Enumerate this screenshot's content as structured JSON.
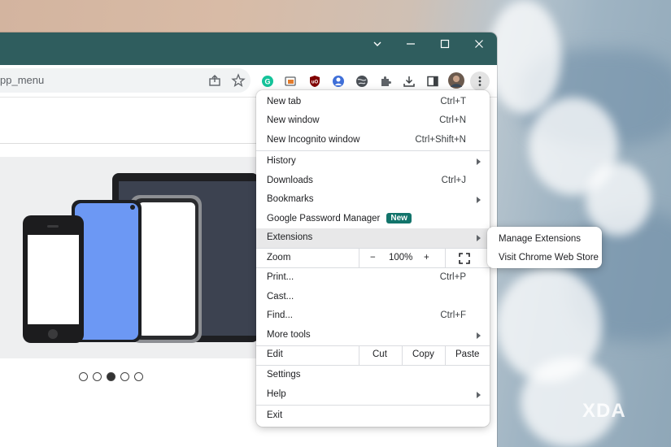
{
  "omnibox": {
    "text": "pp_menu"
  },
  "toolbar": {
    "icons": [
      "share-icon",
      "bookmark-star-icon",
      "grammarly-extension-icon",
      "screenshot-extension-icon",
      "ublock-extension-icon",
      "vpn-extension-icon",
      "globe-extension-icon",
      "extensions-puzzle-icon",
      "download-icon",
      "side-panel-icon",
      "profile-avatar",
      "kebab-menu-icon"
    ]
  },
  "menu": {
    "new_tab": {
      "label": "New tab",
      "shortcut": "Ctrl+T"
    },
    "new_window": {
      "label": "New window",
      "shortcut": "Ctrl+N"
    },
    "new_incognito": {
      "label": "New Incognito window",
      "shortcut": "Ctrl+Shift+N"
    },
    "history": {
      "label": "History"
    },
    "downloads": {
      "label": "Downloads",
      "shortcut": "Ctrl+J"
    },
    "bookmarks": {
      "label": "Bookmarks"
    },
    "password_manager": {
      "label": "Google Password Manager",
      "badge": "New"
    },
    "extensions": {
      "label": "Extensions"
    },
    "zoom": {
      "label": "Zoom",
      "minus": "−",
      "value": "100%",
      "plus": "+"
    },
    "print": {
      "label": "Print...",
      "shortcut": "Ctrl+P"
    },
    "cast": {
      "label": "Cast..."
    },
    "find": {
      "label": "Find...",
      "shortcut": "Ctrl+F"
    },
    "more_tools": {
      "label": "More tools"
    },
    "edit": {
      "label": "Edit",
      "cut": "Cut",
      "copy": "Copy",
      "paste": "Paste"
    },
    "settings": {
      "label": "Settings"
    },
    "help": {
      "label": "Help"
    },
    "exit": {
      "label": "Exit"
    }
  },
  "submenu": {
    "manage_extensions": "Manage Extensions",
    "visit_web_store": "Visit Chrome Web Store"
  },
  "carousel": {
    "dot_count": 5,
    "active_index": 2
  },
  "watermark": "XDA",
  "colors": {
    "titlebar": "#2f5d5e",
    "badge": "#12746b",
    "highlight": "#e8e8e9"
  }
}
